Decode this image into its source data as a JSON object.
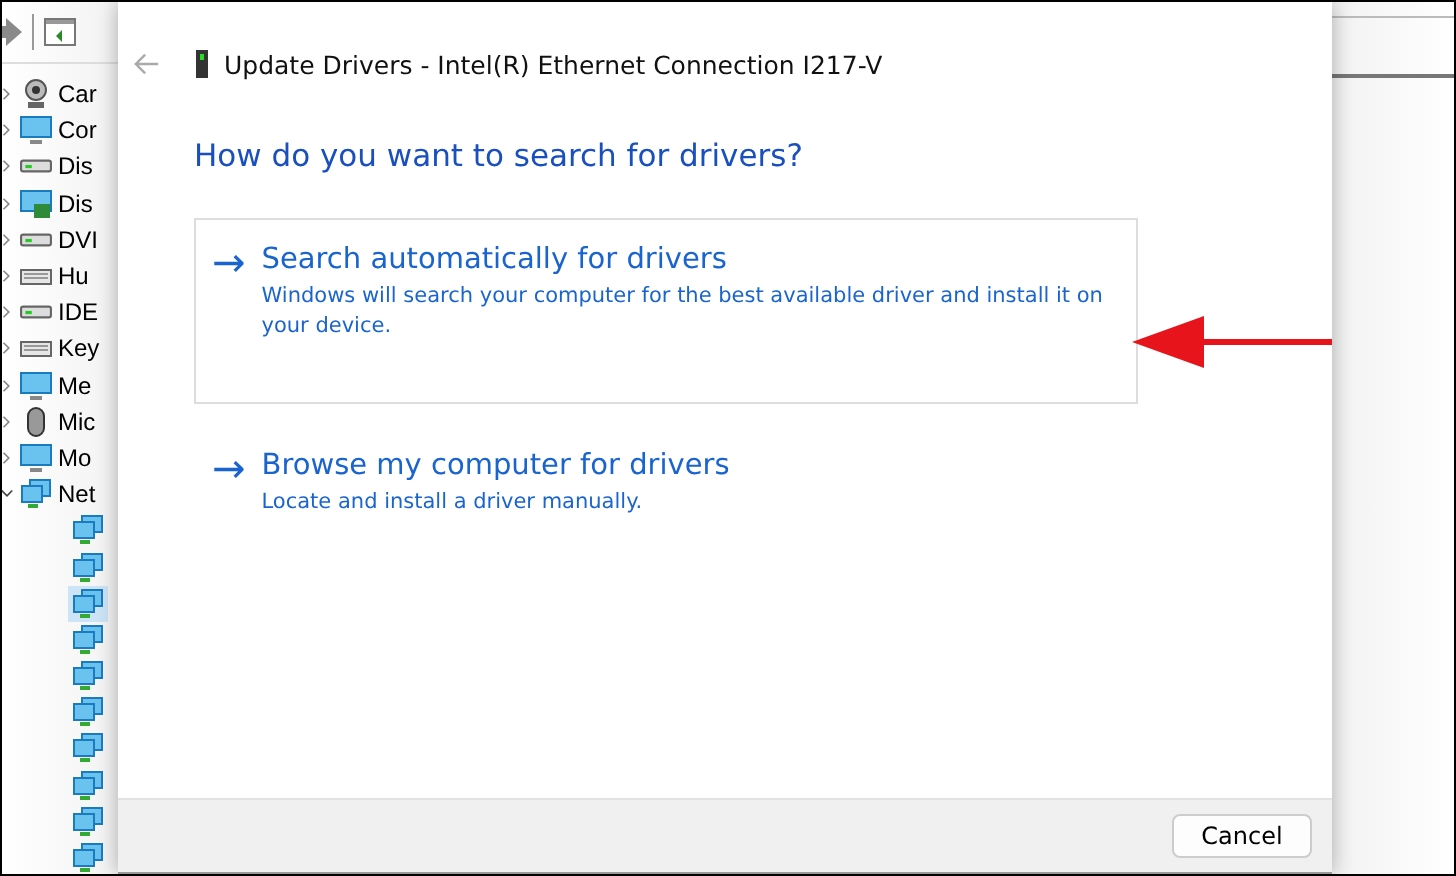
{
  "tree": {
    "items": [
      {
        "label": "Car",
        "kind": "camera",
        "expanded": false
      },
      {
        "label": "Cor",
        "kind": "monitor",
        "expanded": false
      },
      {
        "label": "Dis",
        "kind": "disk",
        "expanded": false
      },
      {
        "label": "Dis",
        "kind": "display",
        "expanded": false
      },
      {
        "label": "DVI",
        "kind": "disk",
        "expanded": false
      },
      {
        "label": "Hu",
        "kind": "keyboard",
        "expanded": false
      },
      {
        "label": "IDE",
        "kind": "disk",
        "expanded": false
      },
      {
        "label": "Key",
        "kind": "keyboard",
        "expanded": false
      },
      {
        "label": "Me",
        "kind": "monitor",
        "expanded": false
      },
      {
        "label": "Mic",
        "kind": "mouse",
        "expanded": false
      },
      {
        "label": "Mo",
        "kind": "monitor",
        "expanded": false
      },
      {
        "label": "Net",
        "kind": "network",
        "expanded": true,
        "children": [
          {
            "selected": false
          },
          {
            "selected": false
          },
          {
            "selected": true
          },
          {
            "selected": false
          },
          {
            "selected": false
          },
          {
            "selected": false
          },
          {
            "selected": false
          },
          {
            "selected": false
          },
          {
            "selected": false
          },
          {
            "selected": false
          }
        ]
      }
    ]
  },
  "dialog": {
    "title": "Update Drivers - Intel(R) Ethernet Connection I217-V",
    "heading": "How do you want to search for drivers?",
    "options": [
      {
        "arrow": "→",
        "title": "Search automatically for drivers",
        "description": "Windows will search your computer for the best available driver and install it on your device.",
        "selected": true
      },
      {
        "arrow": "→",
        "title": "Browse my computer for drivers",
        "description": "Locate and install a driver manually.",
        "selected": false
      }
    ],
    "cancel": "Cancel"
  }
}
